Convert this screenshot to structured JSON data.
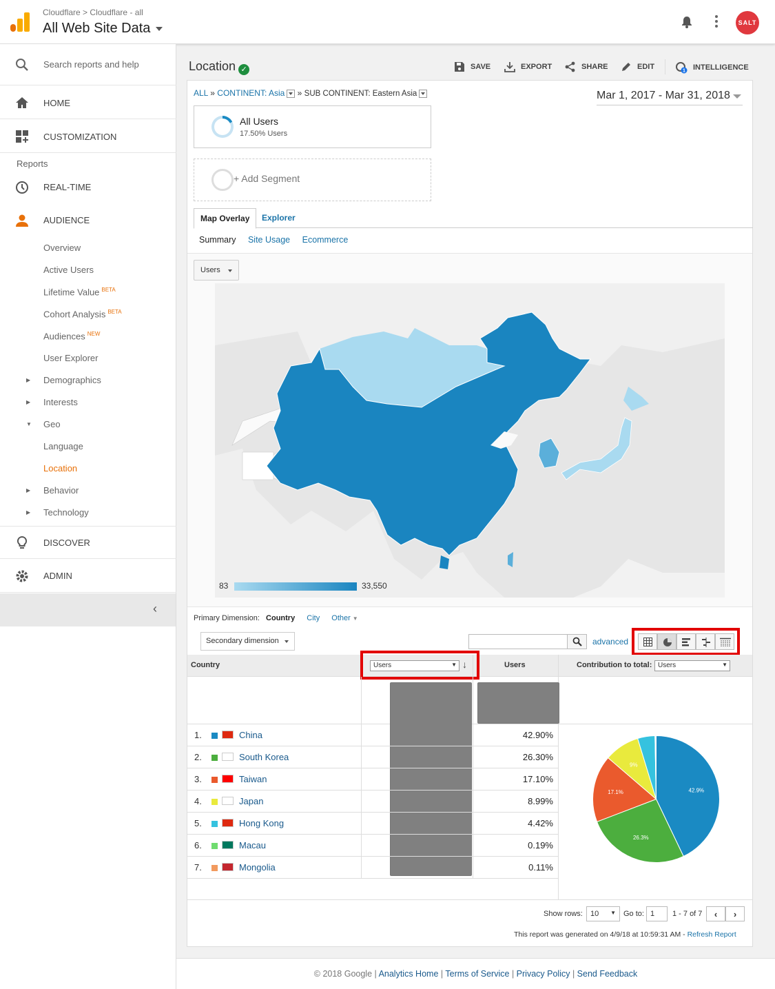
{
  "header": {
    "breadcrumb_account": "Cloudflare",
    "breadcrumb_sep": ">",
    "breadcrumb_property": "Cloudflare - all",
    "view_title": "All Web Site Data",
    "avatar_text": "SALT"
  },
  "sidebar": {
    "search_placeholder": "Search reports and help",
    "home": "HOME",
    "customization": "CUSTOMIZATION",
    "reports_heading": "Reports",
    "realtime": "REAL-TIME",
    "audience": "AUDIENCE",
    "audience_items": [
      {
        "label": "Overview"
      },
      {
        "label": "Active Users"
      },
      {
        "label": "Lifetime Value",
        "badge": "BETA"
      },
      {
        "label": "Cohort Analysis",
        "badge": "BETA"
      },
      {
        "label": "Audiences",
        "badge": "NEW"
      },
      {
        "label": "User Explorer"
      },
      {
        "label": "Demographics"
      },
      {
        "label": "Interests"
      },
      {
        "label": "Geo"
      },
      {
        "label": "Language"
      },
      {
        "label": "Location"
      },
      {
        "label": "Behavior"
      },
      {
        "label": "Technology"
      }
    ],
    "discover": "DISCOVER",
    "admin": "ADMIN",
    "collapse_glyph": "‹"
  },
  "report": {
    "title": "Location",
    "toolbar": {
      "save": "SAVE",
      "export": "EXPORT",
      "share": "SHARE",
      "edit": "EDIT",
      "intelligence": "INTELLIGENCE"
    },
    "filter": {
      "all": "ALL",
      "sep": "»",
      "continent": "CONTINENT: Asia",
      "subcontinent": "SUB CONTINENT: Eastern Asia"
    },
    "date_range": "Mar 1, 2017 - Mar 31, 2018",
    "segment": {
      "name": "All Users",
      "detail": "17.50% Users",
      "add": "+ Add Segment"
    },
    "tabs": [
      "Map Overlay",
      "Explorer"
    ],
    "subtabs": [
      "Summary",
      "Site Usage",
      "Ecommerce"
    ],
    "metric_select": "Users",
    "legend_min": "83",
    "legend_max": "33,550",
    "primary_dimension_label": "Primary Dimension:",
    "primary_dimension_options": [
      "Country",
      "City",
      "Other"
    ],
    "secondary_dimension": "Secondary dimension",
    "advanced": "advanced",
    "table": {
      "col_country": "Country",
      "col_metric_select": "Users",
      "col_users": "Users",
      "col_contribution_label": "Contribution to total:",
      "col_contribution_select": "Users",
      "rows": [
        {
          "rank": "1.",
          "country": "China",
          "pct": "42.90%",
          "color": "#1a8ac3"
        },
        {
          "rank": "2.",
          "country": "South Korea",
          "pct": "26.30%",
          "color": "#4cae3e"
        },
        {
          "rank": "3.",
          "country": "Taiwan",
          "pct": "17.10%",
          "color": "#ea5a2d"
        },
        {
          "rank": "4.",
          "country": "Japan",
          "pct": "8.99%",
          "color": "#e9ea3d"
        },
        {
          "rank": "5.",
          "country": "Hong Kong",
          "pct": "4.42%",
          "color": "#35c2df"
        },
        {
          "rank": "6.",
          "country": "Macau",
          "pct": "0.19%",
          "color": "#6fdc6f"
        },
        {
          "rank": "7.",
          "country": "Mongolia",
          "pct": "0.11%",
          "color": "#f29a5e"
        }
      ]
    },
    "pie": {
      "labels": [
        "42.9%",
        "26.3%",
        "17.1%",
        "9%"
      ]
    },
    "pager": {
      "show_rows_label": "Show rows:",
      "show_rows_value": "10",
      "goto_label": "Go to:",
      "goto_value": "1",
      "range": "1 - 7 of 7"
    },
    "generated_text": "This report was generated on 4/9/18 at 10:59:31 AM -",
    "refresh": "Refresh Report"
  },
  "footer": {
    "copyright": "© 2018 Google",
    "links": [
      "Analytics Home",
      "Terms of Service",
      "Privacy Policy",
      "Send Feedback"
    ]
  },
  "colors": {
    "accent_orange": "#e8710a",
    "link_blue": "#1a73a8",
    "highlight_red": "#e20000",
    "map_dark": "#1a85c0",
    "map_light": "#a9daf0"
  }
}
